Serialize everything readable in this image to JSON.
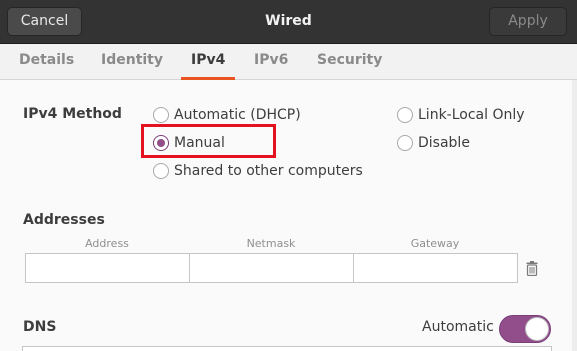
{
  "header": {
    "title": "Wired",
    "cancel_label": "Cancel",
    "apply_label": "Apply"
  },
  "tabs": [
    {
      "label": "Details"
    },
    {
      "label": "Identity"
    },
    {
      "label": "IPv4",
      "active": true
    },
    {
      "label": "IPv6"
    },
    {
      "label": "Security"
    }
  ],
  "ipv4_method": {
    "label": "IPv4 Method",
    "options": [
      {
        "label": "Automatic (DHCP)",
        "selected": false
      },
      {
        "label": "Manual",
        "selected": true
      },
      {
        "label": "Shared to other computers",
        "selected": false
      },
      {
        "label": "Link-Local Only",
        "selected": false
      },
      {
        "label": "Disable",
        "selected": false
      }
    ]
  },
  "addresses": {
    "label": "Addresses",
    "columns": [
      "Address",
      "Netmask",
      "Gateway"
    ],
    "row": {
      "address": "",
      "netmask": "",
      "gateway": ""
    }
  },
  "dns": {
    "label": "DNS",
    "automatic_label": "Automatic",
    "automatic_on": true
  },
  "colors": {
    "accent": "#924d8b",
    "tab_underline": "#e95420",
    "highlight": "#e4121f"
  }
}
